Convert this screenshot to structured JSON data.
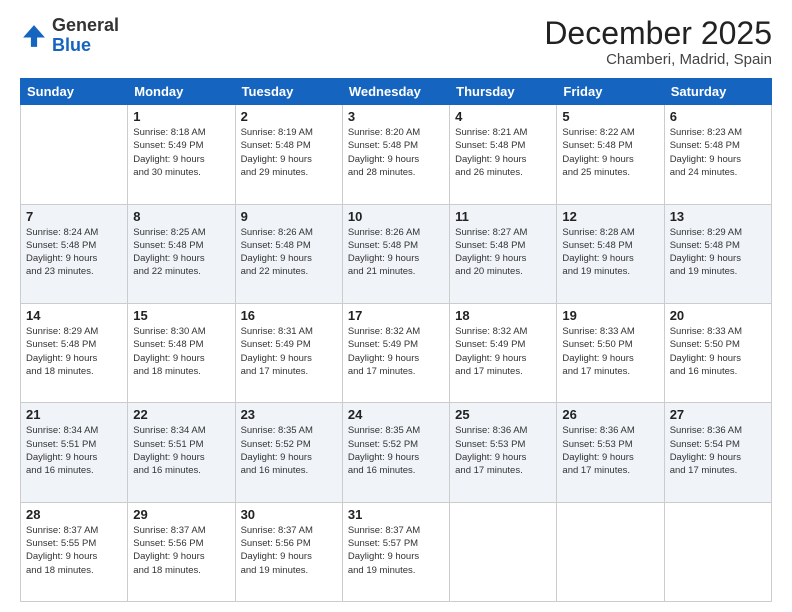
{
  "header": {
    "logo_general": "General",
    "logo_blue": "Blue",
    "month": "December 2025",
    "location": "Chamberi, Madrid, Spain"
  },
  "weekdays": [
    "Sunday",
    "Monday",
    "Tuesday",
    "Wednesday",
    "Thursday",
    "Friday",
    "Saturday"
  ],
  "weeks": [
    [
      {
        "day": "",
        "info": ""
      },
      {
        "day": "1",
        "info": "Sunrise: 8:18 AM\nSunset: 5:49 PM\nDaylight: 9 hours\nand 30 minutes."
      },
      {
        "day": "2",
        "info": "Sunrise: 8:19 AM\nSunset: 5:48 PM\nDaylight: 9 hours\nand 29 minutes."
      },
      {
        "day": "3",
        "info": "Sunrise: 8:20 AM\nSunset: 5:48 PM\nDaylight: 9 hours\nand 28 minutes."
      },
      {
        "day": "4",
        "info": "Sunrise: 8:21 AM\nSunset: 5:48 PM\nDaylight: 9 hours\nand 26 minutes."
      },
      {
        "day": "5",
        "info": "Sunrise: 8:22 AM\nSunset: 5:48 PM\nDaylight: 9 hours\nand 25 minutes."
      },
      {
        "day": "6",
        "info": "Sunrise: 8:23 AM\nSunset: 5:48 PM\nDaylight: 9 hours\nand 24 minutes."
      }
    ],
    [
      {
        "day": "7",
        "info": "Sunrise: 8:24 AM\nSunset: 5:48 PM\nDaylight: 9 hours\nand 23 minutes."
      },
      {
        "day": "8",
        "info": "Sunrise: 8:25 AM\nSunset: 5:48 PM\nDaylight: 9 hours\nand 22 minutes."
      },
      {
        "day": "9",
        "info": "Sunrise: 8:26 AM\nSunset: 5:48 PM\nDaylight: 9 hours\nand 22 minutes."
      },
      {
        "day": "10",
        "info": "Sunrise: 8:26 AM\nSunset: 5:48 PM\nDaylight: 9 hours\nand 21 minutes."
      },
      {
        "day": "11",
        "info": "Sunrise: 8:27 AM\nSunset: 5:48 PM\nDaylight: 9 hours\nand 20 minutes."
      },
      {
        "day": "12",
        "info": "Sunrise: 8:28 AM\nSunset: 5:48 PM\nDaylight: 9 hours\nand 19 minutes."
      },
      {
        "day": "13",
        "info": "Sunrise: 8:29 AM\nSunset: 5:48 PM\nDaylight: 9 hours\nand 19 minutes."
      }
    ],
    [
      {
        "day": "14",
        "info": "Sunrise: 8:29 AM\nSunset: 5:48 PM\nDaylight: 9 hours\nand 18 minutes."
      },
      {
        "day": "15",
        "info": "Sunrise: 8:30 AM\nSunset: 5:48 PM\nDaylight: 9 hours\nand 18 minutes."
      },
      {
        "day": "16",
        "info": "Sunrise: 8:31 AM\nSunset: 5:49 PM\nDaylight: 9 hours\nand 17 minutes."
      },
      {
        "day": "17",
        "info": "Sunrise: 8:32 AM\nSunset: 5:49 PM\nDaylight: 9 hours\nand 17 minutes."
      },
      {
        "day": "18",
        "info": "Sunrise: 8:32 AM\nSunset: 5:49 PM\nDaylight: 9 hours\nand 17 minutes."
      },
      {
        "day": "19",
        "info": "Sunrise: 8:33 AM\nSunset: 5:50 PM\nDaylight: 9 hours\nand 17 minutes."
      },
      {
        "day": "20",
        "info": "Sunrise: 8:33 AM\nSunset: 5:50 PM\nDaylight: 9 hours\nand 16 minutes."
      }
    ],
    [
      {
        "day": "21",
        "info": "Sunrise: 8:34 AM\nSunset: 5:51 PM\nDaylight: 9 hours\nand 16 minutes."
      },
      {
        "day": "22",
        "info": "Sunrise: 8:34 AM\nSunset: 5:51 PM\nDaylight: 9 hours\nand 16 minutes."
      },
      {
        "day": "23",
        "info": "Sunrise: 8:35 AM\nSunset: 5:52 PM\nDaylight: 9 hours\nand 16 minutes."
      },
      {
        "day": "24",
        "info": "Sunrise: 8:35 AM\nSunset: 5:52 PM\nDaylight: 9 hours\nand 16 minutes."
      },
      {
        "day": "25",
        "info": "Sunrise: 8:36 AM\nSunset: 5:53 PM\nDaylight: 9 hours\nand 17 minutes."
      },
      {
        "day": "26",
        "info": "Sunrise: 8:36 AM\nSunset: 5:53 PM\nDaylight: 9 hours\nand 17 minutes."
      },
      {
        "day": "27",
        "info": "Sunrise: 8:36 AM\nSunset: 5:54 PM\nDaylight: 9 hours\nand 17 minutes."
      }
    ],
    [
      {
        "day": "28",
        "info": "Sunrise: 8:37 AM\nSunset: 5:55 PM\nDaylight: 9 hours\nand 18 minutes."
      },
      {
        "day": "29",
        "info": "Sunrise: 8:37 AM\nSunset: 5:56 PM\nDaylight: 9 hours\nand 18 minutes."
      },
      {
        "day": "30",
        "info": "Sunrise: 8:37 AM\nSunset: 5:56 PM\nDaylight: 9 hours\nand 19 minutes."
      },
      {
        "day": "31",
        "info": "Sunrise: 8:37 AM\nSunset: 5:57 PM\nDaylight: 9 hours\nand 19 minutes."
      },
      {
        "day": "",
        "info": ""
      },
      {
        "day": "",
        "info": ""
      },
      {
        "day": "",
        "info": ""
      }
    ]
  ]
}
